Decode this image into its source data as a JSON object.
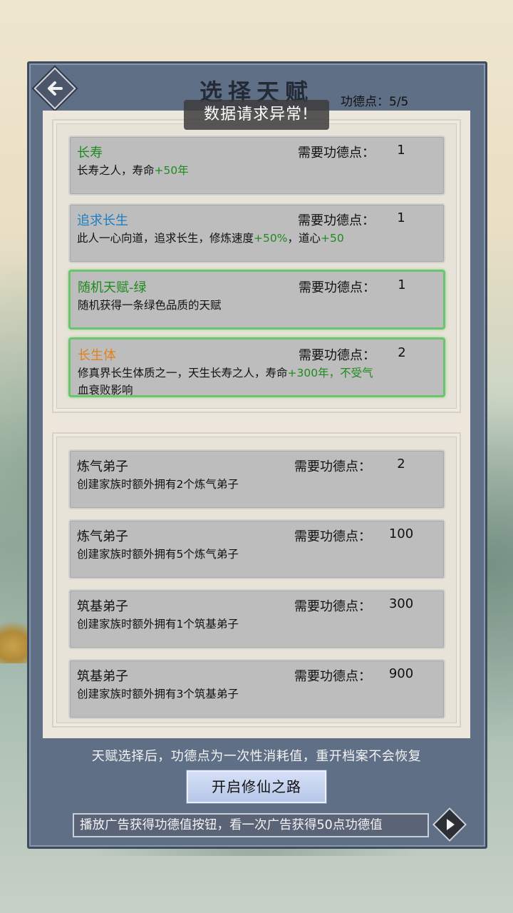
{
  "header": {
    "title": "选择天赋",
    "merit_label": "功德点：",
    "merit_value": "5/5",
    "toast": "数据请求异常!"
  },
  "talents": [
    {
      "name": "长寿",
      "name_color": "#1f8a1f",
      "cost_label": "需要功德点：",
      "cost": "1",
      "desc_a": "长寿之人，寿命",
      "desc_b": "+50年",
      "desc_c": "",
      "desc_d": "",
      "desc_e": "",
      "selected": false
    },
    {
      "name": "追求长生",
      "name_color": "#1b7fc4",
      "cost_label": "需要功德点：",
      "cost": "1",
      "desc_a": "此人一心向道，追求长生，修炼速度",
      "desc_b": "+50%",
      "desc_c": "，道心",
      "desc_d": "+50",
      "desc_e": "",
      "selected": false
    },
    {
      "name": "随机天赋-绿",
      "name_color": "#1f8a1f",
      "cost_label": "需要功德点：",
      "cost": "1",
      "desc_a": "随机获得一条绿色品质的天赋",
      "desc_b": "",
      "desc_c": "",
      "desc_d": "",
      "desc_e": "",
      "selected": true
    },
    {
      "name": "长生体",
      "name_color": "#e0821b",
      "cost_label": "需要功德点：",
      "cost": "2",
      "desc_a": "修真界长生体质之一，天生长寿之人，寿命",
      "desc_b": "+300年，不受气",
      "desc_c": "",
      "desc_d": "",
      "desc_e": "血衰败影响",
      "selected": true
    }
  ],
  "disciples": [
    {
      "name": "炼气弟子",
      "cost_label": "需要功德点：",
      "cost": "2",
      "desc": "创建家族时额外拥有2个炼气弟子"
    },
    {
      "name": "炼气弟子",
      "cost_label": "需要功德点：",
      "cost": "100",
      "desc": "创建家族时额外拥有5个炼气弟子"
    },
    {
      "name": "筑基弟子",
      "cost_label": "需要功德点：",
      "cost": "300",
      "desc": "创建家族时额外拥有1个筑基弟子"
    },
    {
      "name": "筑基弟子",
      "cost_label": "需要功德点：",
      "cost": "900",
      "desc": "创建家族时额外拥有3个筑基弟子"
    }
  ],
  "footer": {
    "notice": "天赋选择后，功德点为一次性消耗值，重开档案不会恢复",
    "start_button": "开启修仙之路",
    "ad_text": "播放广告获得功德值按钮，看一次广告获得50点功德值"
  },
  "icons": {
    "back": "back-arrow-icon",
    "play": "play-icon"
  },
  "colors": {
    "frame": "#5f6f86",
    "highlight_green": "#1f8a1f",
    "selected_border": "#6ec36e"
  }
}
